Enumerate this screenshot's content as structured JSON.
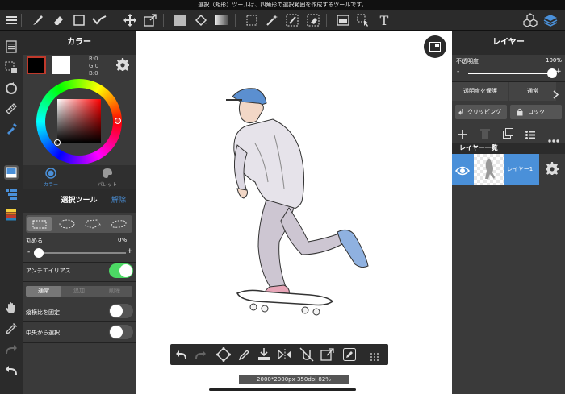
{
  "status_message": "選択（矩形）ツールは、四角形の選択範囲を作成するツールです。",
  "toolbar": {
    "icons": [
      "menu-icon",
      "brush-icon",
      "eraser-icon",
      "rect-shape-icon",
      "stroke-correction-icon",
      "move-icon",
      "transform-icon",
      "fill-color-icon",
      "bucket-icon",
      "gradient-icon",
      "select-rect-icon",
      "magic-wand-icon",
      "select-pen-icon",
      "select-eraser-icon",
      "copy-paste-icon",
      "operation-icon",
      "text-icon",
      "materials-icon",
      "layers-icon"
    ],
    "text_tool_glyph": "T"
  },
  "color_panel": {
    "title": "カラー",
    "rgb": {
      "r": "R:0",
      "g": "G:0",
      "b": "B:0"
    },
    "foreground": "#000000",
    "background": "#ffffff",
    "tab_color": "カラー",
    "tab_palette": "パレット"
  },
  "select_panel": {
    "title": "選択ツール",
    "release": "解除",
    "round_label": "丸める",
    "round_value": "0%",
    "round_fraction": 0.0,
    "antialias_label": "アンチエイリアス",
    "antialias_on": true,
    "modes": [
      "通常",
      "追加",
      "削除"
    ],
    "active_mode": 0,
    "fix_ratio_label": "縦横比を固定",
    "fix_ratio_on": false,
    "from_center_label": "中央から選択",
    "from_center_on": false,
    "minus": "-",
    "plus": "+"
  },
  "canvas": {
    "info": "2000*2000px 350dpi 82%"
  },
  "layer_panel": {
    "title": "レイヤー",
    "opacity_label": "不透明度",
    "opacity_value": "100%",
    "opacity_fraction": 1.0,
    "protect_alpha": "透明度を保護",
    "blend_mode": "通常",
    "clipping": "クリッピング",
    "lock": "ロック",
    "list_title": "レイヤー一覧",
    "layers": [
      {
        "name": "レイヤー1",
        "visible": true
      }
    ],
    "minus": "-",
    "plus": "+"
  },
  "colors": {
    "accent": "#4a90d9",
    "toggle_on": "#4cd964"
  }
}
